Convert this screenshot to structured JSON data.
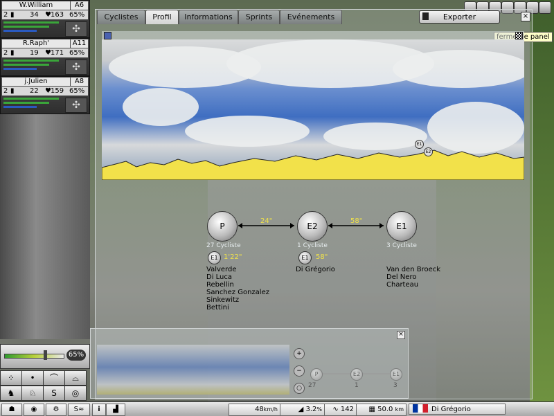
{
  "riders": [
    {
      "name": "W.William",
      "code": "A6",
      "bib": "2",
      "stat1": "34",
      "stat2": "163",
      "pct": "65%"
    },
    {
      "name": "R.Raph'",
      "code": "A11",
      "bib": "2",
      "stat1": "19",
      "stat2": "171",
      "pct": "65%"
    },
    {
      "name": "j.Julien",
      "code": "A8",
      "bib": "2",
      "stat1": "22",
      "stat2": "159",
      "pct": "65%"
    }
  ],
  "tabs": [
    "Cyclistes",
    "Profil",
    "Informations",
    "Sprints",
    "Evénements"
  ],
  "active_tab": "Profil",
  "export_label": "Exporter",
  "close_label": "×",
  "tooltip": "fermer le panel",
  "profile": {
    "marker_e1": "E1",
    "marker_e2": "E2"
  },
  "groups": [
    {
      "label": "P",
      "count": "27 Cycliste",
      "riders": [
        "Valverde",
        "Di Luca",
        "Rebellin",
        "Sanchez Gonzalez",
        "Sinkewitz",
        "Bettini"
      ],
      "sub": "E1",
      "sub_gap": "1'22\""
    },
    {
      "label": "E2",
      "count": "1 Cycliste",
      "riders": [
        "Di Grégorio"
      ],
      "sub": "E1",
      "sub_gap": "58\""
    },
    {
      "label": "E1",
      "count": "3 Cycliste",
      "riders": [
        "Van den Broeck",
        "Del Nero",
        "Charteau"
      ]
    }
  ],
  "gaps": [
    "24\"",
    "58\""
  ],
  "mini": {
    "close_label": "×",
    "nodes": [
      "P",
      "E2",
      "E1"
    ],
    "counts": [
      "27",
      "1",
      "3"
    ]
  },
  "effort": {
    "value": "65%",
    "level": 0.65
  },
  "status": {
    "speed": "48",
    "speed_unit": "km/h",
    "slope": "3.2",
    "slope_unit": "%",
    "heart": "142",
    "distance": "50.0",
    "distance_unit": "km",
    "rider": "Di Grégorio"
  },
  "colors": {
    "gap": "#f0e24a",
    "terrain": "#f2e14a"
  }
}
